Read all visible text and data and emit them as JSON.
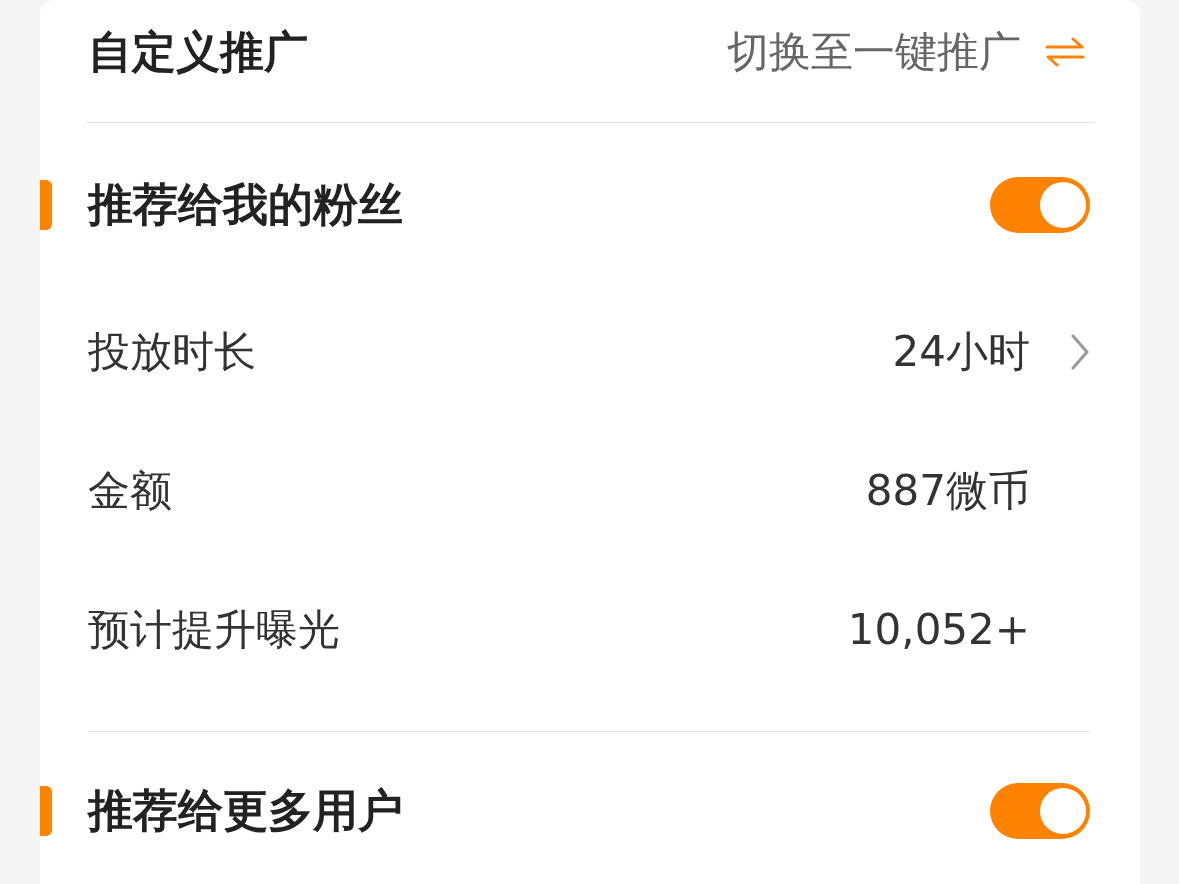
{
  "header": {
    "title": "自定义推广",
    "switch_link": "切换至一键推广"
  },
  "sections": [
    {
      "title": "推荐给我的粉丝",
      "on": true,
      "rows": [
        {
          "kind": "select",
          "label": "投放时长",
          "value": "24小时"
        },
        {
          "kind": "text",
          "label": "金额",
          "value": "887微币"
        },
        {
          "kind": "text",
          "label": "预计提升曝光",
          "value": "10,052+"
        }
      ]
    },
    {
      "title": "推荐给更多用户",
      "on": true
    }
  ]
}
